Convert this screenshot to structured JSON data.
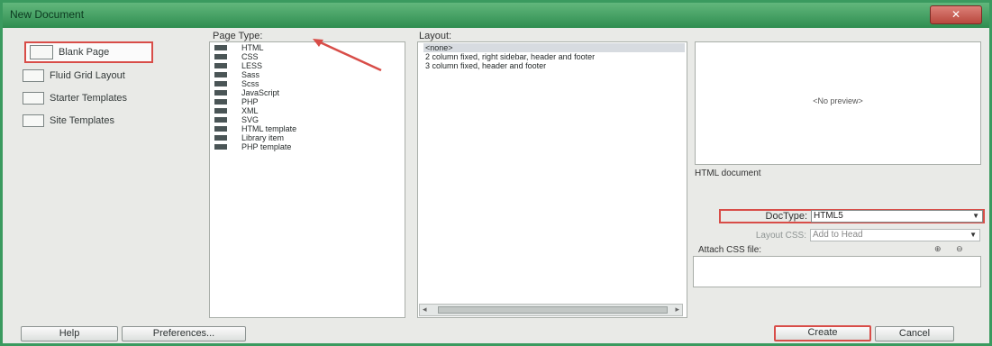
{
  "window": {
    "title": "New Document",
    "close_label": "✕"
  },
  "categories": [
    {
      "label": "Blank Page",
      "selected": true,
      "icon": "blank-page-icon"
    },
    {
      "label": "Fluid Grid Layout",
      "selected": false,
      "icon": "fluid-grid-icon"
    },
    {
      "label": "Starter Templates",
      "selected": false,
      "icon": "starter-templates-icon"
    },
    {
      "label": "Site Templates",
      "selected": false,
      "icon": "site-templates-icon"
    }
  ],
  "page_type": {
    "header": "Page Type:",
    "items": [
      "HTML",
      "CSS",
      "LESS",
      "Sass",
      "Scss",
      "JavaScript",
      "PHP",
      "XML",
      "SVG",
      "HTML template",
      "Library item",
      "PHP template"
    ],
    "selected_index": 0
  },
  "layout": {
    "header": "Layout:",
    "items": [
      "<none>",
      "2 column fixed, right sidebar, header and footer",
      "3 column fixed, header and footer"
    ],
    "selected_index": 0
  },
  "preview": {
    "placeholder": "<No preview>",
    "description": "HTML document"
  },
  "doctype": {
    "label": "DocType:",
    "value": "HTML5"
  },
  "layout_css": {
    "label": "Layout CSS:",
    "value": "Add to Head"
  },
  "attach_css": {
    "label": "Attach CSS file:"
  },
  "buttons": {
    "help": "Help",
    "preferences": "Preferences...",
    "create": "Create",
    "cancel": "Cancel"
  },
  "colors": {
    "highlight_border": "#d84d48",
    "title_green": "#2e8d50"
  }
}
